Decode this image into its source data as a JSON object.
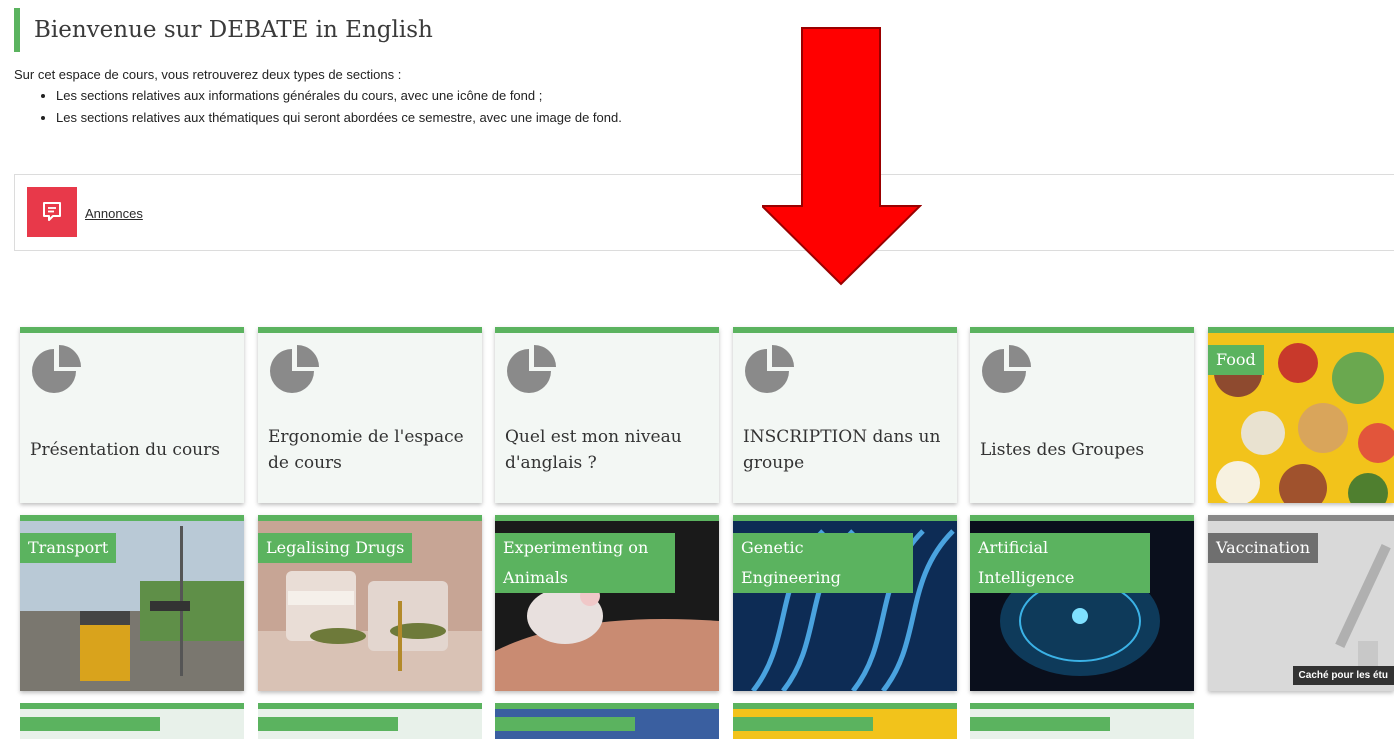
{
  "header": {
    "title": "Bienvenue sur DEBATE in English"
  },
  "intro": {
    "text": "Sur cet espace de cours, vous retrouverez deux types de sections :",
    "bullets": [
      "Les sections relatives aux informations générales du cours, avec une icône de fond ;",
      "Les sections relatives aux thématiques qui seront abordées ce semestre, avec une image de fond."
    ]
  },
  "announcements": {
    "label": "Annonces",
    "icon": "announcement-icon",
    "color": "#e8394a"
  },
  "annotation": {
    "type": "red-arrow-down",
    "color": "#ff0000"
  },
  "tiles_row1": [
    {
      "label": "Présentation du cours",
      "icon": "pie-chart-icon"
    },
    {
      "label": "Ergonomie de l'espace de cours",
      "icon": "pie-chart-icon"
    },
    {
      "label": "Quel est mon niveau d'anglais ?",
      "icon": "pie-chart-icon"
    },
    {
      "label": "INSCRIPTION dans un groupe",
      "icon": "pie-chart-icon"
    },
    {
      "label": "Listes des Groupes",
      "icon": "pie-chart-icon"
    },
    {
      "label": "Food",
      "type": "image"
    }
  ],
  "tiles_row2": [
    {
      "label": "Transport"
    },
    {
      "label": "Legalising Drugs"
    },
    {
      "label": "Experimenting on Animals"
    },
    {
      "label": "Genetic Engineering"
    },
    {
      "label": "Artificial Intelligence"
    },
    {
      "label": "Vaccination",
      "hidden_note": "Caché pour les étu"
    }
  ],
  "colors": {
    "accent": "#5bb35f",
    "tile_bg": "#f3f7f4",
    "icon_gray": "#8a8a8a"
  }
}
